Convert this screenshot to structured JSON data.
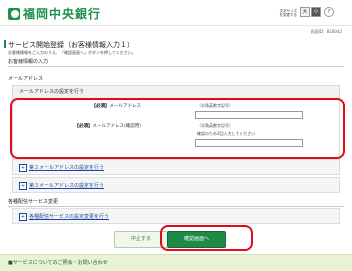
{
  "header": {
    "bank_name": "福岡中央銀行",
    "font_size_label": "文字サイズを変更する",
    "font_big": "大",
    "font_small": "小",
    "help": "?"
  },
  "screen": {
    "id": "画面ID：BL0042",
    "title": "サービス開始登録（お客様情報入力１）",
    "lead": "お客様情報をご入力のうえ、「確認画面へ」ボタンを押してください。"
  },
  "section_customer": {
    "heading": "お客様情報の入力"
  },
  "section_email": {
    "heading": "メールアドレス",
    "box_heading": "メールアドレスの設定を行う",
    "email": {
      "required": "【必須】",
      "label": "メールアドレス",
      "hint": "（半角英数字記号）",
      "value": ""
    },
    "email_confirm": {
      "required": "【必須】",
      "label": "メールアドレス(確認用)",
      "hint": "（半角英数字記号）",
      "hint2": "確認のため2回入力してください",
      "value": ""
    },
    "second_email_link": "第２メールアドレスの設定を行う",
    "third_email_link": "第３メールアドレスの設定を行う"
  },
  "section_notify": {
    "heading": "各種配信サービス変更",
    "link": "各種配信サービスの設定変更を行う"
  },
  "actions": {
    "cancel": "中止する",
    "confirm": "確認画面へ"
  },
  "footer": {
    "text": "■サービスについてのご照会・お問い合わせ"
  },
  "colors": {
    "brand_green": "#1f8f4a",
    "highlight_red": "#e00d18",
    "link_blue": "#1a47a5"
  }
}
